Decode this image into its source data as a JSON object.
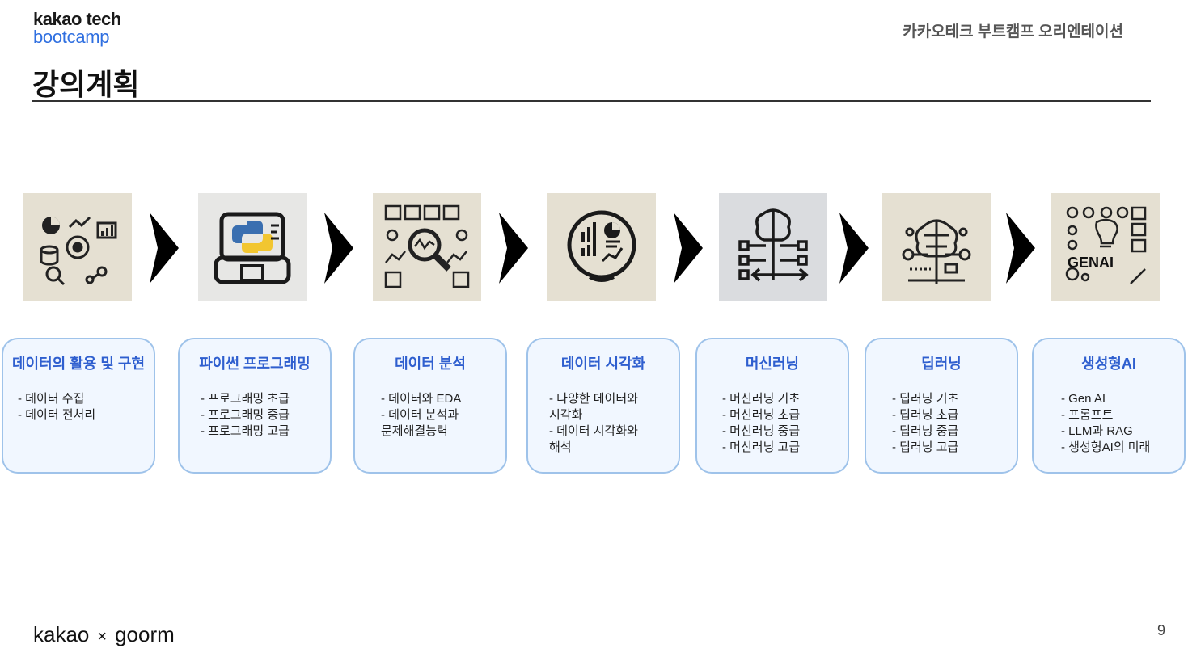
{
  "header": {
    "logo_line1": "kakao tech",
    "logo_line2": "bootcamp",
    "subtitle": "카카오테크 부트캠프 오리엔테이션"
  },
  "page_title": "강의계획",
  "steps": [
    {
      "title": "데이터의 활용 및 구현",
      "items": [
        "- 데이터 수집",
        "- 데이터 전처리"
      ]
    },
    {
      "title": "파이썬 프로그래밍",
      "items": [
        "- 프로그래밍 초급",
        "- 프로그래밍 중급",
        "- 프로그래밍 고급"
      ]
    },
    {
      "title": "데이터 분석",
      "items": [
        "- 데이터와 EDA",
        "- 데이터 분석과",
        "문제해결능력"
      ]
    },
    {
      "title": "데이터 시각화",
      "items": [
        "- 다양한 데이터와",
        "시각화",
        "- 데이터 시각화와",
        "해석"
      ]
    },
    {
      "title": "머신러닝",
      "items": [
        "- 머신러닝 기초",
        "- 머신러닝 초급",
        "- 머신러닝 중급",
        "- 머신러닝 고급"
      ]
    },
    {
      "title": "딥러닝",
      "items": [
        "- 딥러닝 기초",
        "- 딥러닝 초급",
        "- 딥러닝 중급",
        "- 딥러닝 고급"
      ]
    },
    {
      "title": "생성형AI",
      "items": [
        "- Gen AI",
        "- 프롬프트",
        "- LLM과 RAG",
        "- 생성형AI의 미래"
      ]
    }
  ],
  "thumbs": [
    {
      "icon": "data-tools-icon"
    },
    {
      "icon": "python-laptop-icon"
    },
    {
      "icon": "data-analysis-icon"
    },
    {
      "icon": "data-visualization-icon"
    },
    {
      "icon": "machine-learning-icon"
    },
    {
      "icon": "deep-learning-icon"
    },
    {
      "icon": "genai-icon",
      "label": "GENAI"
    }
  ],
  "footer": {
    "brand_left": "kakao",
    "separator": "×",
    "brand_right": "goorm",
    "page_number": "9"
  },
  "colors": {
    "accent": "#2f5fcf",
    "card_border": "#9fc3ea",
    "card_bg": "#f1f7ff"
  }
}
